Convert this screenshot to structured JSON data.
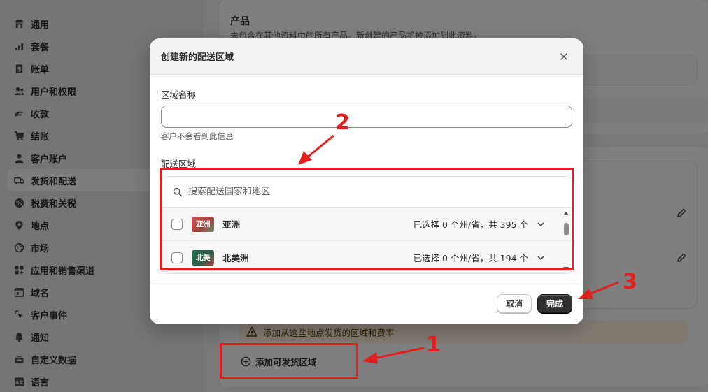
{
  "sidebar": {
    "items": [
      {
        "label": "通用",
        "icon": "store-icon"
      },
      {
        "label": "套餐",
        "icon": "chart-icon"
      },
      {
        "label": "账单",
        "icon": "bill-icon"
      },
      {
        "label": "用户和权限",
        "icon": "users-icon"
      },
      {
        "label": "收款",
        "icon": "payment-icon"
      },
      {
        "label": "结账",
        "icon": "cart-icon"
      },
      {
        "label": "客户账户",
        "icon": "person-icon"
      },
      {
        "label": "发货和配送",
        "icon": "truck-icon",
        "active": true
      },
      {
        "label": "税费和关税",
        "icon": "tax-icon"
      },
      {
        "label": "地点",
        "icon": "location-icon"
      },
      {
        "label": "市场",
        "icon": "globe-icon"
      },
      {
        "label": "应用和销售渠道",
        "icon": "apps-icon"
      },
      {
        "label": "域名",
        "icon": "domain-icon"
      },
      {
        "label": "客户事件",
        "icon": "cursor-icon"
      },
      {
        "label": "通知",
        "icon": "bell-icon"
      },
      {
        "label": "自定义数据",
        "icon": "data-icon"
      },
      {
        "label": "语言",
        "icon": "language-icon"
      }
    ]
  },
  "background": {
    "product_title": "产品",
    "product_desc": "未包含在其他资料中的所有产品。新创建的产品将被添加到此资料。",
    "warning_text": "添加从这些地点发货的区域和费率",
    "add_zone_label": "添加可发货区域"
  },
  "modal": {
    "title": "创建新的配送区域",
    "zone_name_label": "区域名称",
    "zone_name_value": "",
    "zone_name_help": "客户不会看到此信息",
    "zones_label": "配送区域",
    "search_placeholder": "搜索配送国家和地区",
    "zones": [
      {
        "name": "亚洲",
        "flag_text": "亚洲",
        "count_text": "已选择 0 个州/省，共 395 个",
        "flag_color": "#c0392b"
      },
      {
        "name": "北美洲",
        "flag_text": "北美",
        "count_text": "已选择 0 个州/省，共 194 个",
        "flag_color": "#1e6b4f"
      }
    ],
    "cancel_label": "取消",
    "done_label": "完成"
  },
  "annotations": {
    "num1": "1",
    "num2": "2",
    "num3": "3",
    "color": "#e21e1e"
  }
}
